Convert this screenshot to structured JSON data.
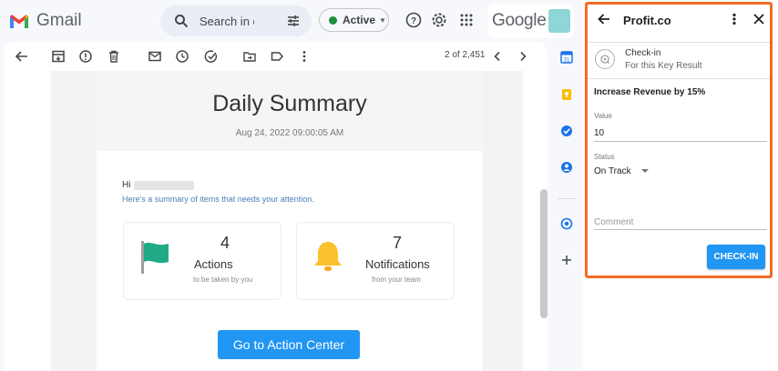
{
  "header": {
    "app_name": "Gmail",
    "search_placeholder": "Search in er",
    "status": "Active",
    "brand": "Google"
  },
  "toolbar": {
    "count": "2 of 2,451"
  },
  "email": {
    "title": "Daily Summary",
    "date": "Aug 24, 2022 09:00:05 AM",
    "greeting": "Hi",
    "summary": "Here's a summary of items that needs your attention.",
    "actions": {
      "count": "4",
      "label": "Actions",
      "sub": "to be taken by you"
    },
    "notifications": {
      "count": "7",
      "label": "Notifications",
      "sub": "from your team"
    },
    "cta": "Go to Action Center"
  },
  "panel": {
    "title": "Profit.co",
    "checkin_title": "Check-in",
    "checkin_sub": "For this Key Result",
    "key_result": "Increase Revenue by 15%",
    "value_label": "Value",
    "value": "10",
    "status_label": "Status",
    "status_value": "On Track",
    "comment_placeholder": "Comment",
    "submit": "CHECK-IN"
  },
  "colors": {
    "accent": "#2196f3",
    "panel_highlight": "#f26b21",
    "active_dot": "#1e8e3e"
  }
}
